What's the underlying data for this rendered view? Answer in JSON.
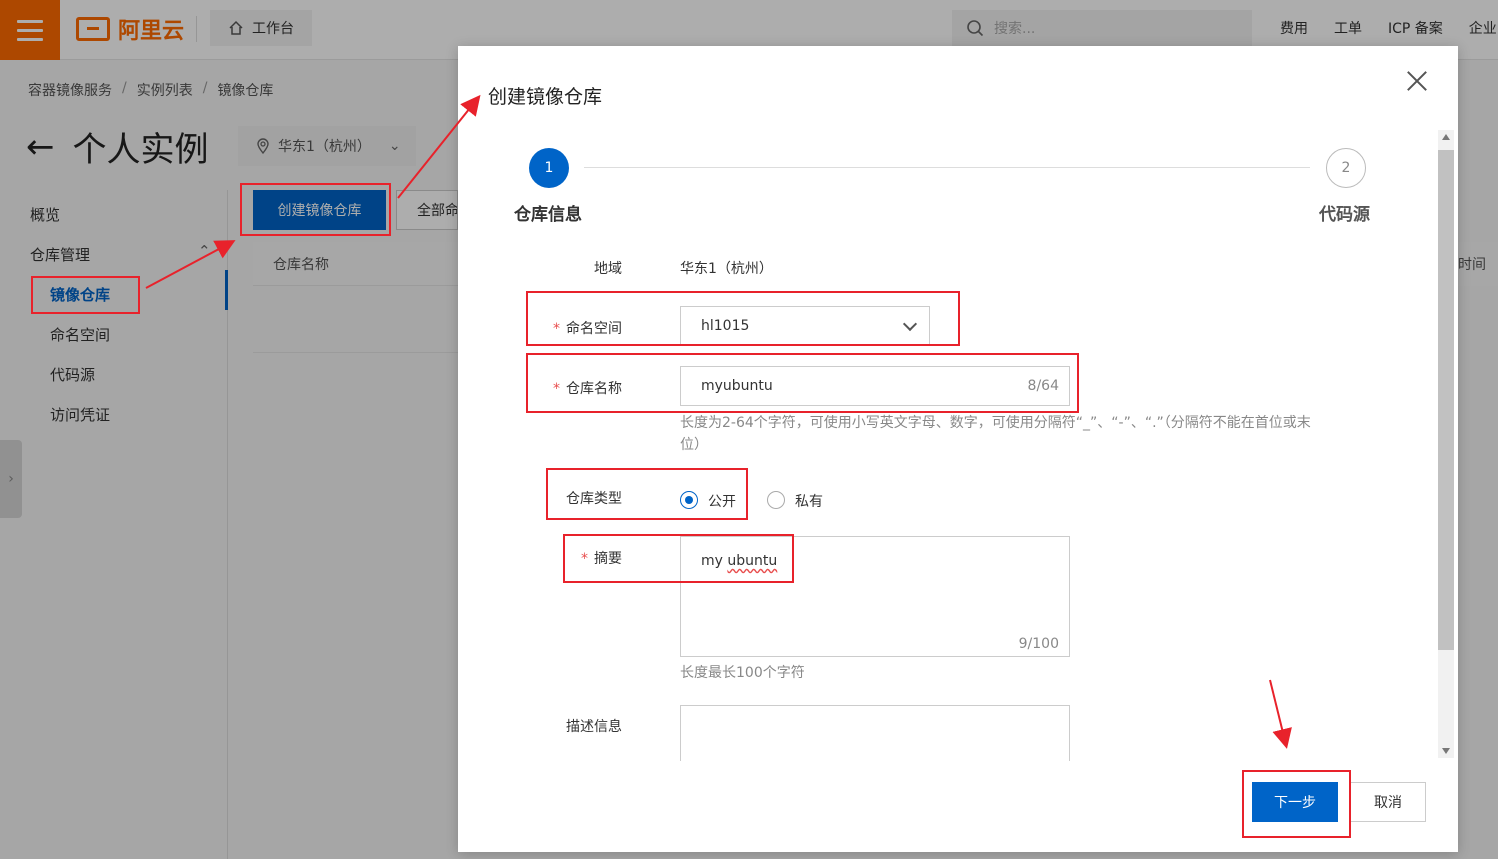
{
  "topbar": {
    "logo_text": "阿里云",
    "workbench_label": "工作台",
    "search_placeholder": "搜索...",
    "links": [
      "费用",
      "工单",
      "ICP 备案",
      "企业"
    ]
  },
  "breadcrumb": [
    "容器镜像服务",
    "实例列表",
    "镜像仓库"
  ],
  "page": {
    "title": "个人实例",
    "region": "华东1（杭州）"
  },
  "sidebar": {
    "items": [
      {
        "label": "概览"
      },
      {
        "label": "仓库管理"
      },
      {
        "label": "镜像仓库"
      },
      {
        "label": "命名空间"
      },
      {
        "label": "代码源"
      },
      {
        "label": "访问凭证"
      }
    ]
  },
  "toolbar": {
    "create_label": "创建镜像仓库",
    "all_namespaces_label": "全部命名空间"
  },
  "table": {
    "col_repo_name": "仓库名称",
    "col_time_partial": "时间"
  },
  "modal": {
    "title": "创建镜像仓库",
    "steps": [
      {
        "number": "1",
        "label": "仓库信息"
      },
      {
        "number": "2",
        "label": "代码源"
      }
    ],
    "region_label": "地域",
    "region_value": "华东1（杭州）",
    "namespace_label": "命名空间",
    "namespace_value": "hl1015",
    "repo_name_label": "仓库名称",
    "repo_name_value": "myubuntu",
    "repo_name_counter": "8/64",
    "repo_name_help": "长度为2-64个字符，可使用小写英文字母、数字，可使用分隔符“_”、“-”、“.”（分隔符不能在首位或末位）",
    "repo_type_label": "仓库类型",
    "repo_type_public": "公开",
    "repo_type_private": "私有",
    "summary_label": "摘要",
    "summary_value_prefix": "my ",
    "summary_value_word": "ubuntu",
    "summary_counter": "9/100",
    "summary_help": "长度最长100个字符",
    "description_label": "描述信息",
    "next_label": "下一步",
    "cancel_label": "取消"
  },
  "colors": {
    "brand_orange": "#ff6a00",
    "primary_blue": "#0064c8",
    "annotation_red": "#e8222b"
  }
}
